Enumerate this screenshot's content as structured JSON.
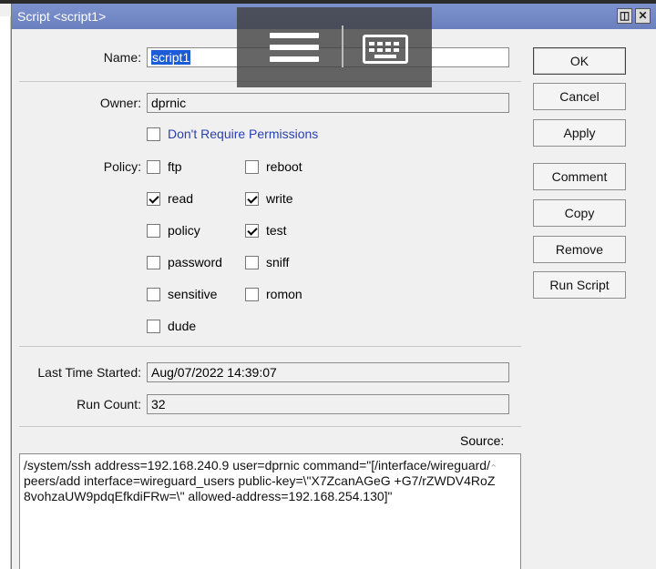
{
  "window": {
    "title": "Script <script1>",
    "restore_glyph": "◫",
    "close_glyph": "✕"
  },
  "overlay": {
    "menu_icon": "hamburger-icon",
    "keyboard_icon": "keyboard-icon"
  },
  "form": {
    "name_label": "Name:",
    "name_value": "script1",
    "owner_label": "Owner:",
    "owner_value": "dprnic",
    "dont_require_label": "Don't Require Permissions",
    "dont_require_checked": false,
    "policy_label": "Policy:",
    "policies": [
      {
        "label": "ftp",
        "checked": false
      },
      {
        "label": "reboot",
        "checked": false
      },
      {
        "label": "read",
        "checked": true
      },
      {
        "label": "write",
        "checked": true
      },
      {
        "label": "policy",
        "checked": false
      },
      {
        "label": "test",
        "checked": true
      },
      {
        "label": "password",
        "checked": false
      },
      {
        "label": "sniff",
        "checked": false
      },
      {
        "label": "sensitive",
        "checked": false
      },
      {
        "label": "romon",
        "checked": false
      },
      {
        "label": "dude",
        "checked": false
      }
    ],
    "last_time_label": "Last Time Started:",
    "last_time_value": "Aug/07/2022 14:39:07",
    "run_count_label": "Run Count:",
    "run_count_value": "32",
    "source_label": "Source:",
    "source_value": "/system/ssh address=192.168.240.9 user=dprnic command=\"[/interface/wireguard/peers/add interface=wireguard_users public-key=\\\"X7ZcanAGeG +G7/rZWDV4RoZ8vohzaUW9pdqEfkdiFRw=\\\" allowed-address=192.168.254.130]\""
  },
  "buttons": {
    "ok": "OK",
    "cancel": "Cancel",
    "apply": "Apply",
    "comment": "Comment",
    "copy": "Copy",
    "remove": "Remove",
    "run_script": "Run Script"
  },
  "colors": {
    "titlebar": "#6f84c2",
    "selection": "#1c5bd6",
    "link_blue": "#2a3fb0"
  }
}
